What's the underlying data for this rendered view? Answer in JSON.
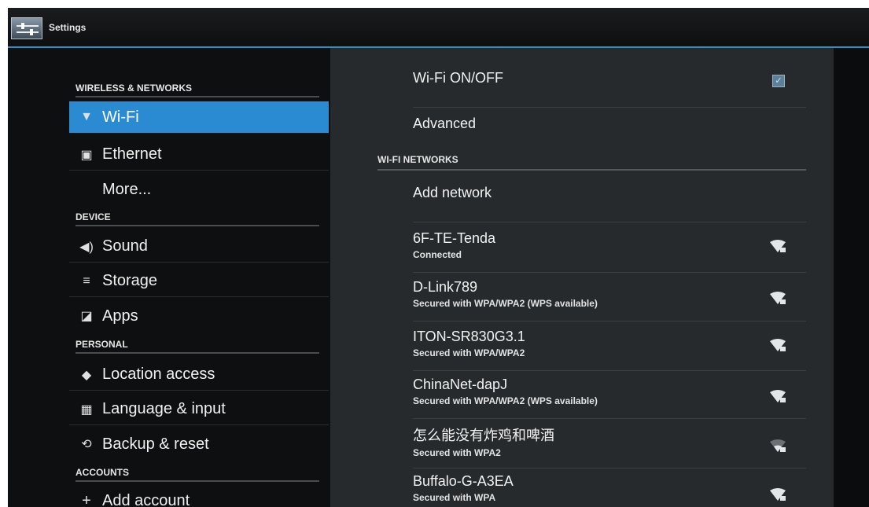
{
  "app": {
    "title": "Settings"
  },
  "sidebar": {
    "sections": [
      {
        "header": "WIRELESS & NETWORKS"
      },
      {
        "header": "DEVICE"
      },
      {
        "header": "PERSONAL"
      },
      {
        "header": "ACCOUNTS"
      }
    ],
    "items": [
      {
        "label": "Wi-Fi",
        "icon": "wifi-icon",
        "selected": true
      },
      {
        "label": "Ethernet",
        "icon": "ethernet-icon"
      },
      {
        "label": "More..."
      },
      {
        "label": "Sound",
        "icon": "speaker-icon"
      },
      {
        "label": "Storage",
        "icon": "storage-icon"
      },
      {
        "label": "Apps",
        "icon": "apps-icon"
      },
      {
        "label": "Location access",
        "icon": "location-icon"
      },
      {
        "label": "Language & input",
        "icon": "keyboard-icon"
      },
      {
        "label": "Backup & reset",
        "icon": "backup-icon"
      },
      {
        "label": "Add account",
        "icon": "plus-icon"
      }
    ]
  },
  "wifi": {
    "toggle_label": "Wi-Fi ON/OFF",
    "toggle_checked": true,
    "advanced_label": "Advanced",
    "networks_header": "WI-FI NETWORKS",
    "add_network_label": "Add network",
    "networks": [
      {
        "ssid": "6F-TE-Tenda",
        "status": "Connected"
      },
      {
        "ssid": "D-Link789",
        "status": "Secured with WPA/WPA2 (WPS available)"
      },
      {
        "ssid": "ITON-SR830G3.1",
        "status": "Secured with WPA/WPA2"
      },
      {
        "ssid": "ChinaNet-dapJ",
        "status": "Secured with WPA/WPA2 (WPS available)"
      },
      {
        "ssid": "怎么能没有炸鸡和啤酒",
        "status": "Secured with WPA2"
      },
      {
        "ssid": "Buffalo-G-A3EA",
        "status": "Secured with WPA"
      }
    ]
  },
  "colors": {
    "accent": "#2a8ad2",
    "action_bar_line": "#2e8fc0",
    "detail_pane": "#262a2d",
    "background": "#0e0f10"
  }
}
